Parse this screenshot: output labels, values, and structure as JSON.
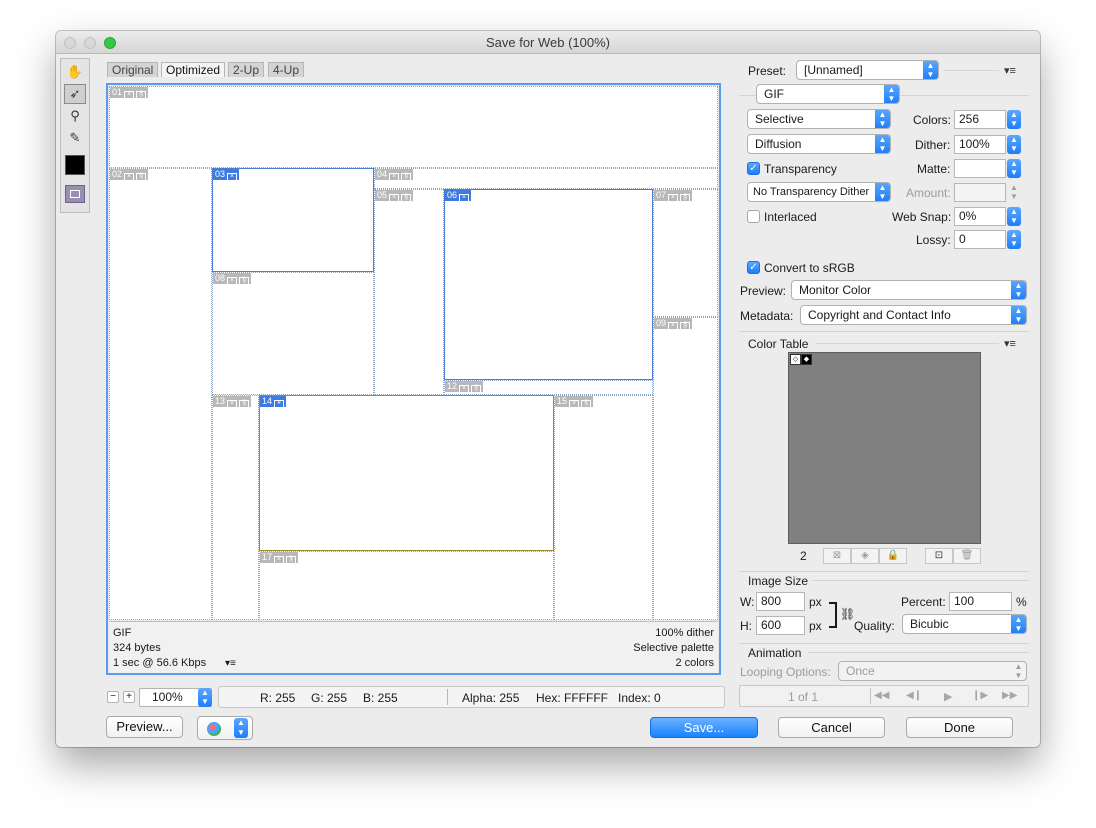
{
  "window": {
    "title": "Save for Web (100%)"
  },
  "toolbox": {
    "tools": [
      {
        "name": "hand-tool-icon",
        "glyph": "✋"
      },
      {
        "name": "slice-select-tool-icon",
        "glyph": "➶"
      },
      {
        "name": "zoom-tool-icon",
        "glyph": "⚲"
      },
      {
        "name": "eyedropper-tool-icon",
        "glyph": "✎"
      }
    ],
    "eyedropper_color": "#000000"
  },
  "tabs": [
    "Original",
    "Optimized",
    "2-Up",
    "4-Up"
  ],
  "slices": [
    {
      "id": "01"
    },
    {
      "id": "02"
    },
    {
      "id": "03"
    },
    {
      "id": "04"
    },
    {
      "id": "05"
    },
    {
      "id": "06"
    },
    {
      "id": "07"
    },
    {
      "id": "08"
    },
    {
      "id": "09"
    },
    {
      "id": "12"
    },
    {
      "id": "13"
    },
    {
      "id": "14"
    },
    {
      "id": "15"
    },
    {
      "id": "17"
    }
  ],
  "canvas_info": {
    "format": "GIF",
    "size": "324 bytes",
    "speed": "1 sec @ 56.6 Kbps",
    "dither": "100% dither",
    "palette": "Selective palette",
    "colors": "2 colors"
  },
  "zoom": {
    "value": "100%",
    "minus": "−",
    "plus": "+"
  },
  "status": {
    "r": "R: 255",
    "g": "G: 255",
    "b": "B: 255",
    "alpha": "Alpha: 255",
    "hex": "Hex: FFFFFF",
    "index": "Index: 0"
  },
  "buttons": {
    "preview": "Preview...",
    "save": "Save...",
    "cancel": "Cancel",
    "done": "Done"
  },
  "settings": {
    "preset_label": "Preset:",
    "preset_value": "[Unnamed]",
    "format": "GIF",
    "reduction": "Selective",
    "dither_algo": "Diffusion",
    "colors_label": "Colors:",
    "colors_value": "256",
    "dither_label": "Dither:",
    "dither_value": "100%",
    "transparency_label": "Transparency",
    "transparency_checked": true,
    "matte_label": "Matte:",
    "matte_value": "",
    "transparency_dither": "No Transparency Dither",
    "amount_label": "Amount:",
    "amount_value": "",
    "interlaced_label": "Interlaced",
    "interlaced_checked": false,
    "websnap_label": "Web Snap:",
    "websnap_value": "0%",
    "lossy_label": "Lossy:",
    "lossy_value": "0",
    "srgb_label": "Convert to sRGB",
    "srgb_checked": true,
    "preview_label": "Preview:",
    "preview_value": "Monitor Color",
    "metadata_label": "Metadata:",
    "metadata_value": "Copyright and Contact Info"
  },
  "color_table": {
    "title": "Color Table",
    "count": "2",
    "swatches": [
      "#ffffff",
      "#000000"
    ]
  },
  "image_size": {
    "title": "Image Size",
    "w_label": "W:",
    "w_value": "800",
    "w_unit": "px",
    "h_label": "H:",
    "h_value": "600",
    "h_unit": "px",
    "percent_label": "Percent:",
    "percent_value": "100",
    "percent_unit": "%",
    "quality_label": "Quality:",
    "quality_value": "Bicubic"
  },
  "animation": {
    "title": "Animation",
    "looping_label": "Looping Options:",
    "looping_value": "Once",
    "frame_counter": "1 of 1"
  },
  "colors": {
    "accent": "#1d7ef9",
    "slice_selected": "#4a7fd6",
    "slice_gold": "#a08a2c"
  }
}
